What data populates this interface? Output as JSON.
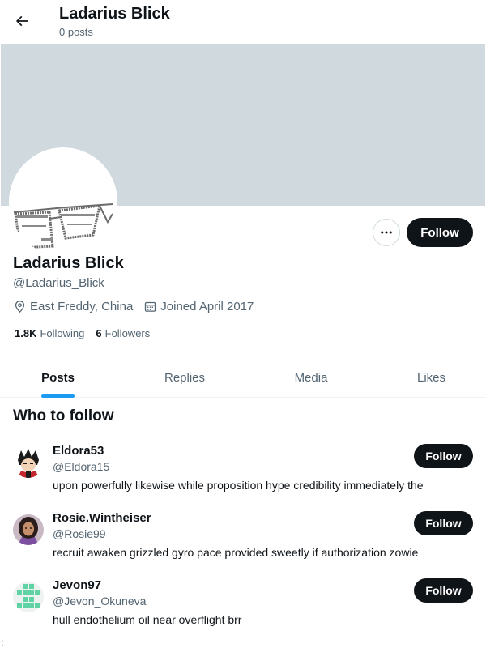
{
  "header": {
    "title": "Ladarius Blick",
    "subtitle": "0 posts",
    "back_icon": "arrow-left-icon"
  },
  "profile": {
    "name": "Ladarius Blick",
    "handle": "@Ladarius_Blick",
    "location": "East Freddy, China",
    "joined": "Joined April 2017",
    "following_count": "1.8K",
    "following_label": "Following",
    "followers_count": "6",
    "followers_label": "Followers",
    "follow_label": "Follow",
    "more_icon": "more-horizontal-icon"
  },
  "tabs": [
    {
      "label": "Posts",
      "active": true
    },
    {
      "label": "Replies",
      "active": false
    },
    {
      "label": "Media",
      "active": false
    },
    {
      "label": "Likes",
      "active": false
    }
  ],
  "who_to_follow": {
    "title": "Who to follow",
    "users": [
      {
        "name": "Eldora53",
        "handle": "@Eldora15",
        "bio": "upon powerfully likewise while proposition hype credibility immediately the",
        "follow_label": "Follow"
      },
      {
        "name": "Rosie.Wintheiser",
        "handle": "@Rosie99",
        "bio": "recruit awaken grizzled gyro pace provided sweetly if authorization zowie",
        "follow_label": "Follow"
      },
      {
        "name": "Jevon97",
        "handle": "@Jevon_Okuneva",
        "bio": "hull endothelium oil near overflight brr",
        "follow_label": "Follow"
      }
    ]
  },
  "stray_text": ":",
  "colors": {
    "banner": "#cfd9de",
    "accent": "#1d9bf0",
    "text": "#0f1419",
    "muted": "#536471",
    "button": "#0f1419"
  }
}
